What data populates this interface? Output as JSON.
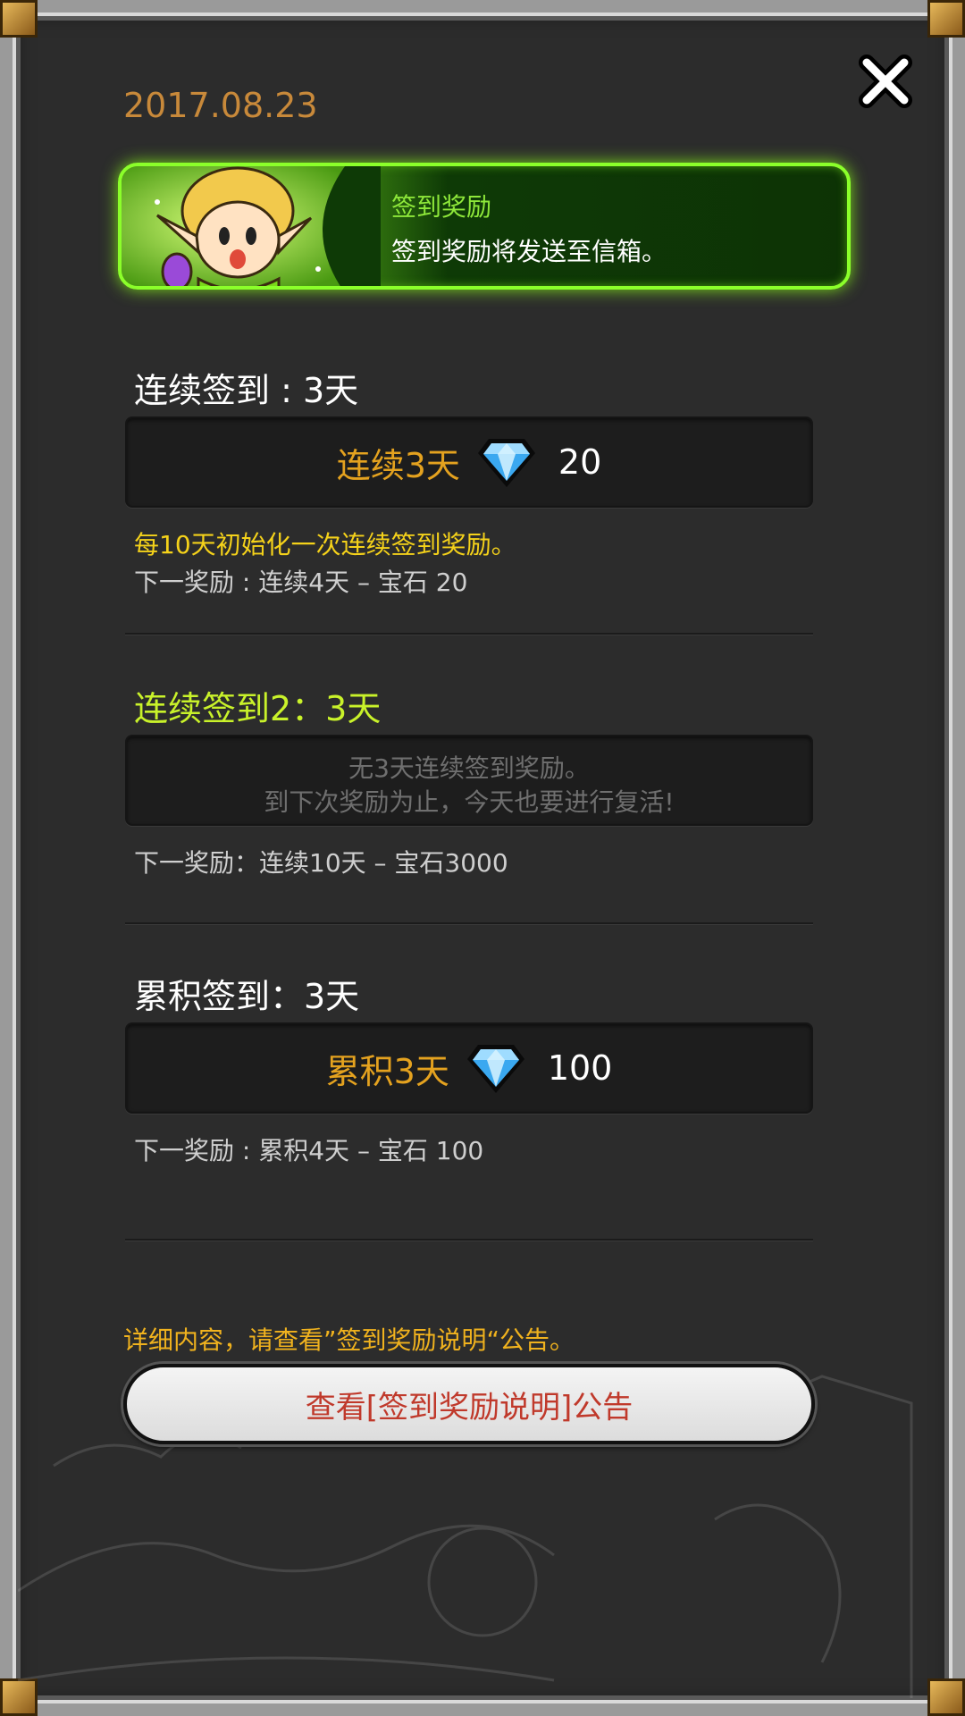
{
  "date": "2017.08.23",
  "banner": {
    "title": "签到奖励",
    "subtitle": "签到奖励将发送至信箱。"
  },
  "consecutive": {
    "heading": "连续签到 : 3天",
    "reward_label": "连续3天",
    "reward_value": "20",
    "note_reset": "每10天初始化一次连续签到奖励。",
    "note_next": "下一奖励 : 连续4天 – 宝石 20"
  },
  "consecutive2": {
    "heading": "连续签到2：3天",
    "empty_line1": "无3天连续签到奖励。",
    "empty_line2": "到下次奖励为止，今天也要进行复活!",
    "note_next": "下一奖励：连续10天 – 宝石3000"
  },
  "cumulative": {
    "heading": "累积签到：3天",
    "reward_label": "累积3天",
    "reward_value": "100",
    "note_next": "下一奖励 : 累积4天 – 宝石 100"
  },
  "footer": {
    "detail_text": "详细内容，请查看”签到奖励说明“公告。",
    "button_label": "查看[签到奖励说明]公告"
  },
  "icons": {
    "close": "close-icon",
    "gem": "diamond-icon",
    "character": "elf-character"
  },
  "colors": {
    "accent_orange": "#e4a21f",
    "accent_green": "#8bff2a",
    "heading_green": "#c9f22a",
    "note_yellow": "#f5d21a",
    "button_text": "#c0392b"
  }
}
